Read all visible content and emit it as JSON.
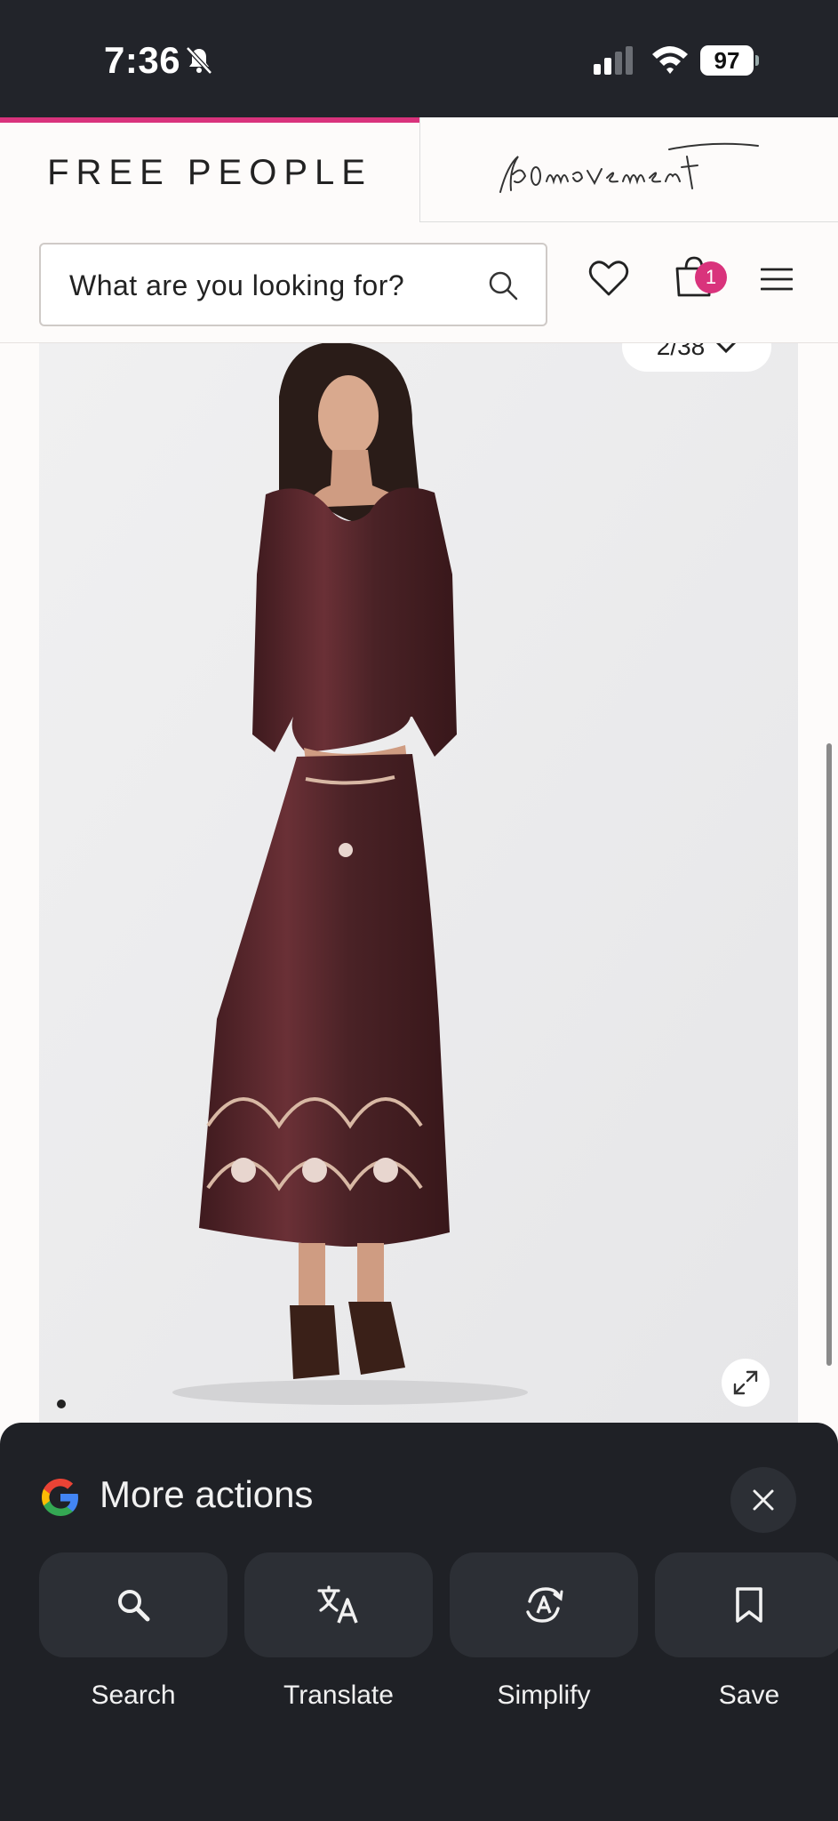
{
  "status_bar": {
    "time": "7:36",
    "battery": "97"
  },
  "brand_tabs": {
    "free_people": "FREE PEOPLE",
    "movement": "fp movement"
  },
  "header": {
    "search_placeholder": "What are you looking for?",
    "cart_count": "1"
  },
  "product": {
    "qty_label": "2/38"
  },
  "bottom_sheet": {
    "title": "More actions",
    "actions": [
      {
        "label": "Search",
        "icon": "search-icon"
      },
      {
        "label": "Translate",
        "icon": "translate-icon"
      },
      {
        "label": "Simplify",
        "icon": "simplify-icon"
      },
      {
        "label": "Save",
        "icon": "bookmark-icon"
      }
    ]
  },
  "colors": {
    "accent": "#d9337c",
    "sheet_bg": "#1f2126",
    "status_bg": "#22242a"
  }
}
